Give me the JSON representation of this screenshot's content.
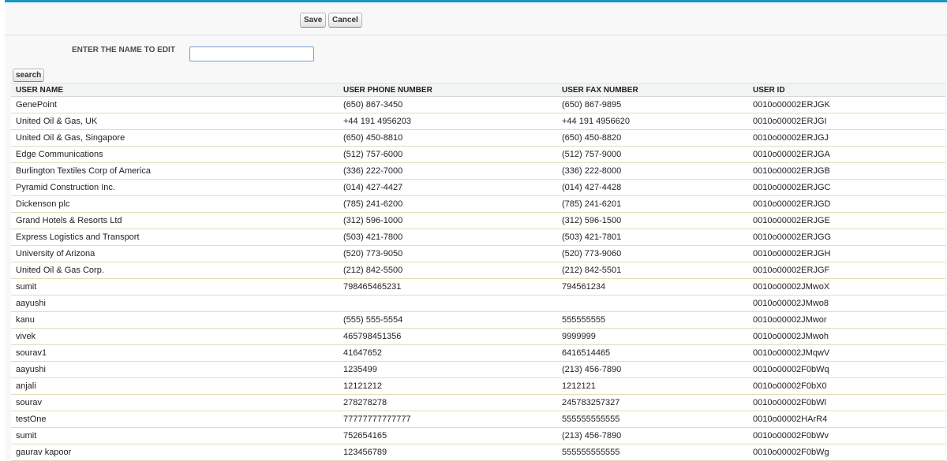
{
  "toolbar": {
    "save_label": "Save",
    "cancel_label": "Cancel"
  },
  "form": {
    "label": "ENTER THE NAME TO EDIT",
    "value": "",
    "search_label": "search"
  },
  "table": {
    "headers": [
      "USER NAME",
      "USER PHONE NUMBER",
      "USER FAX NUMBER",
      "USER ID"
    ],
    "rows": [
      [
        "GenePoint",
        "(650) 867-3450",
        "(650) 867-9895",
        "0010o00002ERJGK"
      ],
      [
        "United Oil & Gas, UK",
        "+44 191 4956203",
        "+44 191 4956620",
        "0010o00002ERJGI"
      ],
      [
        "United Oil & Gas, Singapore",
        "(650) 450-8810",
        "(650) 450-8820",
        "0010o00002ERJGJ"
      ],
      [
        "Edge Communications",
        "(512) 757-6000",
        "(512) 757-9000",
        "0010o00002ERJGA"
      ],
      [
        "Burlington Textiles Corp of America",
        "(336) 222-7000",
        "(336) 222-8000",
        "0010o00002ERJGB"
      ],
      [
        "Pyramid Construction Inc.",
        "(014) 427-4427",
        "(014) 427-4428",
        "0010o00002ERJGC"
      ],
      [
        "Dickenson plc",
        "(785) 241-6200",
        "(785) 241-6201",
        "0010o00002ERJGD"
      ],
      [
        "Grand Hotels & Resorts Ltd",
        "(312) 596-1000",
        "(312) 596-1500",
        "0010o00002ERJGE"
      ],
      [
        "Express Logistics and Transport",
        "(503) 421-7800",
        "(503) 421-7801",
        "0010o00002ERJGG"
      ],
      [
        "University of Arizona",
        "(520) 773-9050",
        "(520) 773-9060",
        "0010o00002ERJGH"
      ],
      [
        "United Oil & Gas Corp.",
        "(212) 842-5500",
        "(212) 842-5501",
        "0010o00002ERJGF"
      ],
      [
        "sumit",
        "798465465231",
        "794561234",
        "0010o00002JMwoX"
      ],
      [
        "aayushi",
        "",
        "",
        "0010o00002JMwo8"
      ],
      [
        "kanu",
        "(555) 555-5554",
        "555555555",
        "0010o00002JMwor"
      ],
      [
        "vivek",
        "465798451356",
        "9999999",
        "0010o00002JMwoh"
      ],
      [
        "sourav1",
        "41647652",
        "6416514465",
        "0010o00002JMqwV"
      ],
      [
        "aayushi",
        "1235499",
        "(213) 456-7890",
        "0010o00002F0bWq"
      ],
      [
        "anjali",
        "12121212",
        "1212121",
        "0010o00002F0bX0"
      ],
      [
        "sourav",
        "278278278",
        "245783257327",
        "0010o00002F0bWl"
      ],
      [
        "testOne",
        "77777777777777",
        "555555555555",
        "0010o00002HArR4"
      ],
      [
        "sumit",
        "752654165",
        "(213) 456-7890",
        "0010o00002F0bWv"
      ],
      [
        "gaurav kapoor",
        "123456789",
        "555555555555",
        "0010o00002F0bWg"
      ]
    ]
  }
}
